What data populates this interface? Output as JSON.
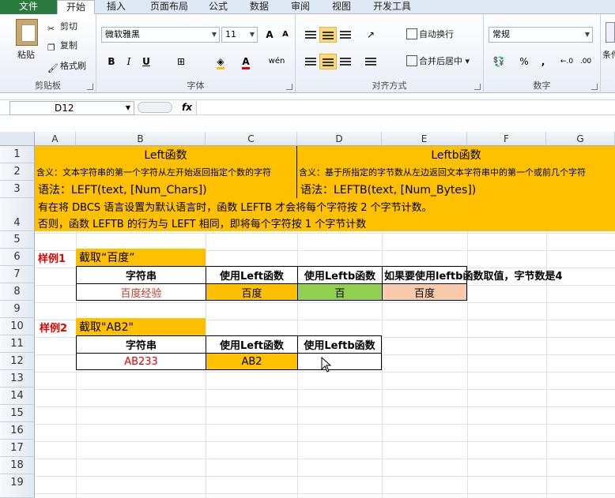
{
  "tabs": {
    "file": "文件",
    "home": "开始",
    "insert": "插入",
    "layout": "页面布局",
    "formula": "公式",
    "data": "数据",
    "review": "审阅",
    "view": "视图",
    "developer": "开发工具"
  },
  "clipboard": {
    "paste": "粘贴",
    "cut": "剪切",
    "copy": "复制",
    "format_painter": "格式刷",
    "label": "剪贴板"
  },
  "font": {
    "name": "微软雅黑",
    "size": "11",
    "grow": "A",
    "shrink": "A",
    "bold": "B",
    "italic": "I",
    "underline": "U",
    "font_color": "A",
    "phonetic": "wén",
    "label": "字体"
  },
  "alignment": {
    "wrap": "自动换行",
    "merge": "合并后居中",
    "label": "对齐方式"
  },
  "number": {
    "format": "常规",
    "percent": "%",
    "comma": ",",
    "label": "数字"
  },
  "styles": {
    "conditional": "条件"
  },
  "formula_bar": {
    "name_box": "D12",
    "fx": "fx",
    "content": ""
  },
  "columns": [
    "A",
    "B",
    "C",
    "D",
    "E",
    "F",
    "G"
  ],
  "rows": [
    "1",
    "2",
    "3",
    "4",
    "5",
    "6",
    "7",
    "8",
    "9",
    "10",
    "11",
    "12",
    "13",
    "14",
    "15",
    "16",
    "17",
    "18",
    "19"
  ],
  "sheet": {
    "left_title": "Left函数",
    "leftb_title": "Leftb函数",
    "left_meaning": "含义：文本字符串的第一个字符从左开始返回指定个数的字符",
    "leftb_meaning": "含义：基于所指定的字节数从左边返回文本字符串中的第一个或前几个字符",
    "left_syntax": "语法：LEFT(text, [Num_Chars])",
    "leftb_syntax": "语法：LEFTB(text, [Num_Bytes])",
    "note1": "有在将 DBCS 语言设置为默认语言时，函数 LEFTB 才会将每个字符按 2 个字节计数。",
    "note2": "否则，函数 LEFTB 的行为与 LEFT 相同，即将每个字符按 1 个字节计数",
    "ex1_label": "样例1",
    "ex1_title": "截取“百度”",
    "ex1_headers": [
      "字符串",
      "使用Left函数",
      "使用Leftb函数",
      "如果要使用leftb函数取值，字节数是4"
    ],
    "ex1_values": [
      "百度经验",
      "百度",
      "百",
      "百度"
    ],
    "ex2_label": "样例2",
    "ex2_title": "截取\"AB2\"",
    "ex2_headers": [
      "字符串",
      "使用Left函数",
      "使用Leftb函数"
    ],
    "ex2_values": [
      "AB233",
      "AB2",
      ""
    ]
  },
  "colors": {
    "orange": "#ffc000",
    "green": "#92d050",
    "peach": "#f8cbad",
    "red": "#e00000"
  }
}
